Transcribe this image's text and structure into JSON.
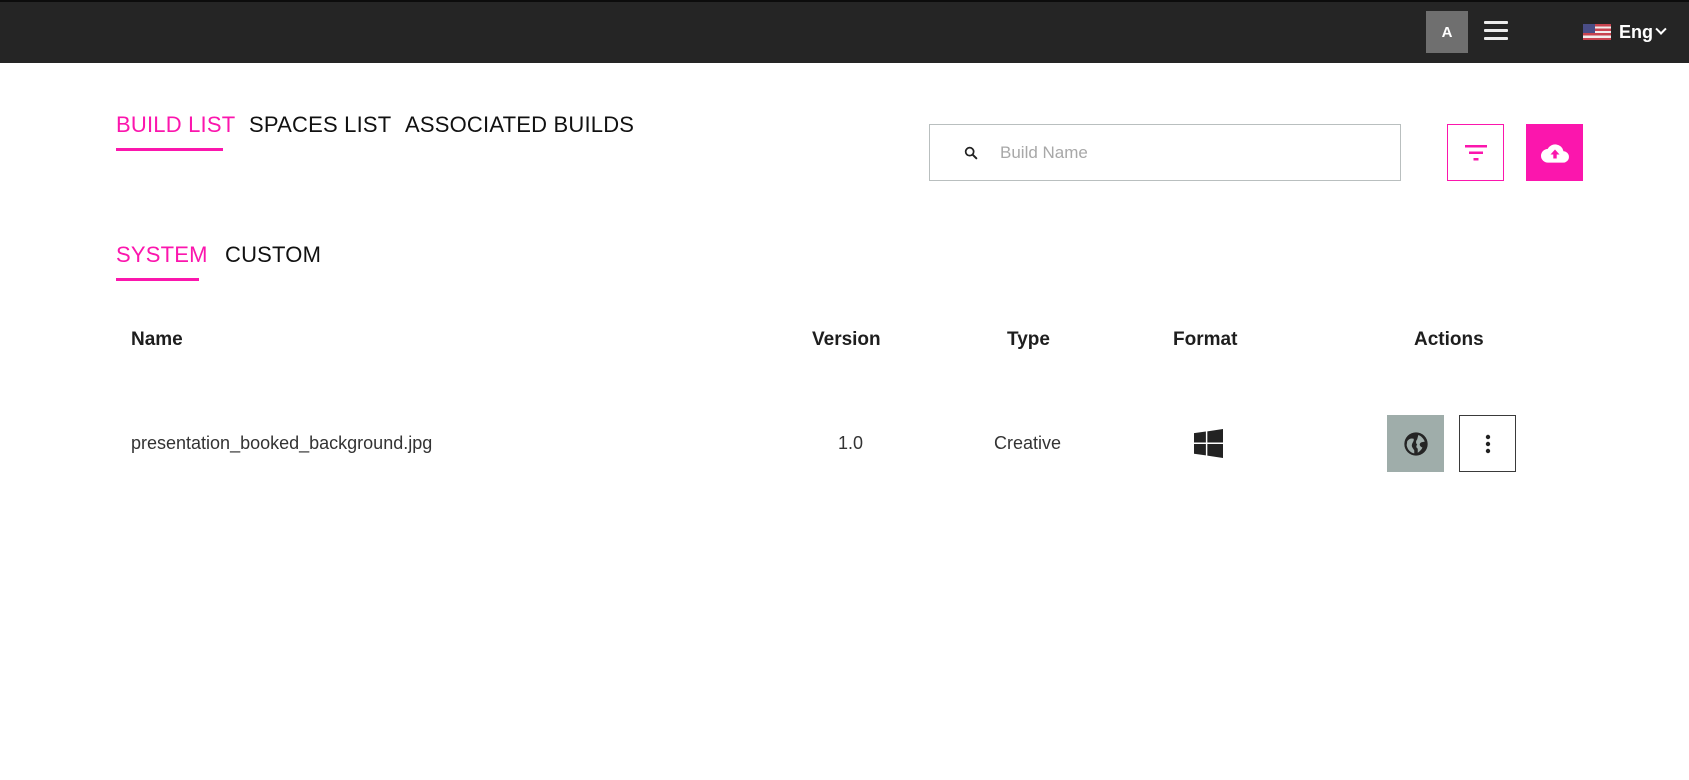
{
  "topbar": {
    "avatar_initial": "A",
    "language_label": "Eng",
    "language_flag": "us-flag-icon"
  },
  "main_tabs": [
    {
      "label": "BUILD LIST",
      "active": true
    },
    {
      "label": "SPACES LIST",
      "active": false
    },
    {
      "label": "ASSOCIATED BUILDS",
      "active": false
    }
  ],
  "search": {
    "placeholder": "Build Name",
    "value": ""
  },
  "toolbar": {
    "filter_icon": "filter-icon",
    "upload_icon": "cloud-upload-icon"
  },
  "sub_tabs": [
    {
      "label": "SYSTEM",
      "active": true
    },
    {
      "label": "CUSTOM",
      "active": false
    }
  ],
  "table": {
    "columns": [
      "Name",
      "Version",
      "Type",
      "Format",
      "Actions"
    ],
    "rows": [
      {
        "name": "presentation_booked_background.jpg",
        "version": "1.0",
        "type": "Creative",
        "format": "windows-icon",
        "actions": [
          "globe-icon",
          "more-vertical-icon"
        ]
      }
    ]
  },
  "colors": {
    "accent": "#fb16ad",
    "topbar": "#252525",
    "action_globe_bg": "#9fadaa"
  }
}
